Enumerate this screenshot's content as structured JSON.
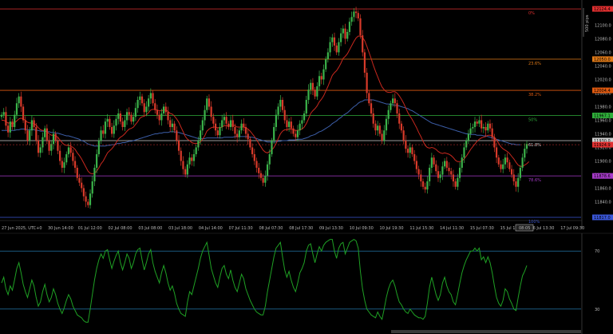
{
  "chart_data": [
    {
      "type": "candlestick",
      "title": "",
      "scale_label": "500 pips",
      "ylim": [
        11817,
        12130
      ],
      "price_ticks": [
        12100,
        12080,
        12060,
        12040,
        12020,
        12000,
        11980,
        11960,
        11940,
        11920,
        11900,
        11880,
        11860,
        11840
      ],
      "price_tick_labels": [
        "12100.0",
        "12080.0",
        "12060.0",
        "12040.0",
        "12020.0",
        "12000.0",
        "11980.0",
        "11960.0",
        "11940.0",
        "11920.0",
        "11900.0",
        "11880.0",
        "11860.0",
        "11840.0"
      ],
      "time_labels": [
        "27 Jun 2025, UTC+0",
        "30 Jun 14:00",
        "01 Jul 12:00",
        "02 Jul 08:00",
        "03 Jul 08:00",
        "03 Jul 18:00",
        "04 Jul 14:00",
        "07 Jul 11:30",
        "08 Jul 07:30",
        "08 Jul 17:30",
        "09 Jul 13:30",
        "10 Jul 09:30",
        "10 Jul 19:30",
        "11 Jul 15:30",
        "14 Jul 11:30",
        "15 Jul 07:30",
        "15 Jul 17:30",
        "16 Jul 13:30",
        "17 Jul 09:30"
      ],
      "cursor_time_label": "08:05",
      "fib_levels": [
        {
          "label": "0%",
          "price": 12124,
          "color": "#e03030",
          "tag": "12124.4"
        },
        {
          "label": "23.6%",
          "price": 12050,
          "color": "#e07a18",
          "tag": "12050.0"
        },
        {
          "label": "38.2%",
          "price": 12004,
          "color": "#e05a10",
          "tag": "12004.4"
        },
        {
          "label": "50%",
          "price": 11967,
          "color": "#2fae3a",
          "tag": "11967.1"
        },
        {
          "label": "61.8%",
          "price": 11930,
          "color": "#cfcfcf",
          "tag": "11930.0"
        },
        {
          "label": "78.6%",
          "price": 11878,
          "color": "#a63ac8",
          "tag": "11878.6"
        },
        {
          "label": "100%",
          "price": 11817,
          "color": "#3a56d6",
          "tag": "11817.0"
        }
      ],
      "current_price": {
        "price": 11924,
        "tag": "11924.9",
        "color": "#e03030"
      },
      "series_closes": [
        11968,
        11972,
        11952,
        11942,
        11958,
        11950,
        11968,
        11985,
        11995,
        11980,
        11960,
        11945,
        11930,
        11945,
        11960,
        11950,
        11930,
        11912,
        11920,
        11935,
        11948,
        11930,
        11915,
        11925,
        11940,
        11930,
        11915,
        11900,
        11890,
        11898,
        11910,
        11920,
        11912,
        11900,
        11890,
        11875,
        11868,
        11860,
        11848,
        11840,
        11835,
        11852,
        11870,
        11890,
        11910,
        11930,
        11945,
        11940,
        11958,
        11962,
        11950,
        11940,
        11952,
        11962,
        11970,
        11958,
        11950,
        11960,
        11972,
        11968,
        11958,
        11965,
        11978,
        11990,
        11995,
        11985,
        11972,
        11980,
        11992,
        12000,
        11985,
        11975,
        11968,
        11960,
        11970,
        11980,
        11972,
        11960,
        11950,
        11955,
        11945,
        11930,
        11915,
        11900,
        11888,
        11880,
        11895,
        11905,
        11900,
        11910,
        11920,
        11930,
        11945,
        11960,
        11975,
        11992,
        11980,
        11965,
        11955,
        11945,
        11938,
        11950,
        11960,
        11965,
        11955,
        11950,
        11960,
        11950,
        11940,
        11935,
        11945,
        11955,
        11950,
        11940,
        11932,
        11920,
        11910,
        11900,
        11890,
        11882,
        11875,
        11868,
        11878,
        11895,
        11910,
        11930,
        11950,
        11968,
        11980,
        11990,
        11975,
        11960,
        11950,
        11958,
        11948,
        11940,
        11935,
        11945,
        11955,
        11960,
        11970,
        11990,
        12005,
        12015,
        12005,
        11995,
        12010,
        12025,
        12020,
        12035,
        12050,
        12060,
        12075,
        12082,
        12070,
        12060,
        12075,
        12088,
        12095,
        12080,
        12090,
        12105,
        12112,
        12120,
        12118,
        12110,
        12085,
        12060,
        12030,
        12000,
        11985,
        11970,
        11955,
        11945,
        11952,
        11940,
        11930,
        11945,
        11962,
        11975,
        11985,
        11992,
        11985,
        11970,
        11955,
        11945,
        11930,
        11918,
        11912,
        11920,
        11910,
        11900,
        11888,
        11880,
        11870,
        11862,
        11858,
        11870,
        11890,
        11905,
        11895,
        11885,
        11875,
        11880,
        11892,
        11900,
        11890,
        11885,
        11880,
        11870,
        11862,
        11875,
        11890,
        11905,
        11920,
        11930,
        11940,
        11948,
        11950,
        11958,
        11955,
        11960,
        11948,
        11950,
        11945,
        11955,
        11948,
        11935,
        11920,
        11905,
        11895,
        11888,
        11895,
        11905,
        11898,
        11888,
        11880,
        11870,
        11862,
        11875,
        11890,
        11905,
        11918,
        11925
      ],
      "ema_fast": [
        11960,
        11960,
        11958,
        11956,
        11956,
        11955,
        11956,
        11959,
        11962,
        11963,
        11962,
        11960,
        11957,
        11956,
        11956,
        11955,
        11953,
        11949,
        11946,
        11945,
        11945,
        11943,
        11940,
        11938,
        11938,
        11937,
        11935,
        11931,
        11927,
        11924,
        11923,
        11923,
        11922,
        11920,
        11917,
        11912,
        11908,
        11903,
        11897,
        11891,
        11885,
        11882,
        11881,
        11882,
        11885,
        11890,
        11896,
        11900,
        11906,
        11912,
        11915,
        11918,
        11922,
        11927,
        11932,
        11935,
        11937,
        11940,
        11944,
        11947,
        11948,
        11950,
        11954,
        11958,
        11963,
        11965,
        11966,
        11968,
        11971,
        11975,
        11976,
        11976,
        11975,
        11974,
        11974,
        11975,
        11975,
        11973,
        11970,
        11969,
        11966,
        11962,
        11957,
        11950,
        11943,
        11936,
        11932,
        11930,
        11927,
        11926,
        11926,
        11926,
        11928,
        11932,
        11937,
        11944,
        11947,
        11949,
        11950,
        11950,
        11949,
        11949,
        11950,
        11952,
        11952,
        11952,
        11953,
        11953,
        11952,
        11950,
        11950,
        11950,
        11950,
        11949,
        11947,
        11944,
        11940,
        11936,
        11931,
        11926,
        11921,
        11916,
        11913,
        11912,
        11914,
        11916,
        11920,
        11926,
        11933,
        11940,
        11944,
        11946,
        11946,
        11947,
        11947,
        11946,
        11945,
        11945,
        11946,
        11947,
        11950,
        11955,
        11962,
        11970,
        11974,
        11977,
        11981,
        11987,
        11991,
        11996,
        12003,
        12010,
        12018,
        12026,
        12030,
        12033,
        12038,
        12044,
        12051,
        12054,
        12058,
        12064,
        12070,
        12076,
        12081,
        12084,
        12084,
        12082,
        12077,
        12069,
        12060,
        12051,
        12041,
        12032,
        12024,
        12016,
        12009,
        12005,
        12002,
        12001,
        12001,
        12002,
        12002,
        12000,
        11996,
        11991,
        11985,
        11978,
        11971,
        11966,
        11961,
        11955,
        11949,
        11942,
        11936,
        11929,
        11923,
        11920,
        11919,
        11920,
        11919,
        11917,
        11914,
        11912,
        11911,
        11912,
        11911,
        11910,
        11908,
        11905,
        11901,
        11899,
        11899,
        11900,
        11903,
        11907,
        11912,
        11917,
        11921,
        11925,
        11929,
        11932,
        11934,
        11935,
        11936,
        11938,
        11938,
        11937,
        11935,
        11931,
        11926,
        11921,
        11918,
        11916,
        11914,
        11911,
        11907,
        11903,
        11898,
        11894,
        11892,
        11892,
        11894,
        11896,
        11899
      ],
      "ema_slow": [
        11945,
        11945,
        11945,
        11945,
        11945,
        11945,
        11945,
        11946,
        11946,
        11947,
        11947,
        11947,
        11946,
        11946,
        11946,
        11946,
        11945,
        11945,
        11944,
        11944,
        11944,
        11943,
        11943,
        11942,
        11942,
        11941,
        11941,
        11940,
        11939,
        11938,
        11937,
        11937,
        11936,
        11935,
        11934,
        11933,
        11932,
        11930,
        11929,
        11927,
        11925,
        11924,
        11923,
        11922,
        11922,
        11922,
        11922,
        11922,
        11922,
        11923,
        11923,
        11924,
        11924,
        11925,
        11926,
        11926,
        11927,
        11927,
        11928,
        11929,
        11929,
        11930,
        11931,
        11932,
        11933,
        11934,
        11935,
        11936,
        11937,
        11938,
        11939,
        11940,
        11940,
        11941,
        11941,
        11942,
        11942,
        11942,
        11943,
        11943,
        11943,
        11942,
        11942,
        11941,
        11940,
        11939,
        11938,
        11937,
        11936,
        11935,
        11934,
        11933,
        11933,
        11933,
        11933,
        11934,
        11934,
        11934,
        11934,
        11934,
        11934,
        11934,
        11934,
        11935,
        11935,
        11935,
        11935,
        11935,
        11936,
        11936,
        11936,
        11936,
        11936,
        11936,
        11936,
        11935,
        11935,
        11934,
        11933,
        11932,
        11931,
        11930,
        11929,
        11928,
        11928,
        11928,
        11928,
        11928,
        11929,
        11929,
        11930,
        11930,
        11930,
        11931,
        11931,
        11931,
        11931,
        11932,
        11932,
        11932,
        11933,
        11934,
        11935,
        11937,
        11938,
        11939,
        11941,
        11943,
        11944,
        11946,
        11948,
        11950,
        11952,
        11955,
        11957,
        11959,
        11962,
        11964,
        11967,
        11969,
        11971,
        11974,
        11977,
        11980,
        11982,
        11985,
        11987,
        11988,
        11990,
        11990,
        11990,
        11990,
        11990,
        11989,
        11988,
        11987,
        11986,
        11985,
        11984,
        11984,
        11983,
        11983,
        11982,
        11982,
        11981,
        11980,
        11979,
        11978,
        11977,
        11975,
        11974,
        11972,
        11970,
        11968,
        11966,
        11964,
        11962,
        11960,
        11958,
        11956,
        11955,
        11954,
        11953,
        11952,
        11951,
        11950,
        11949,
        11948,
        11947,
        11946,
        11945,
        11944,
        11943,
        11942,
        11941,
        11940,
        11940,
        11939,
        11939,
        11939,
        11938,
        11938,
        11938,
        11937,
        11937,
        11936,
        11935,
        11934,
        11933,
        11932,
        11931,
        11930,
        11929,
        11928,
        11927,
        11926,
        11925,
        11925,
        11924,
        11924,
        11924
      ],
      "colors": {
        "up": "#3bb34a",
        "down": "#d83a2a",
        "ema_fast": "#c8281e",
        "ema_slow": "#3c5ea8"
      }
    },
    {
      "type": "line",
      "title": "",
      "ylim": [
        20,
        80
      ],
      "levels": [
        70,
        30
      ],
      "level_labels": [
        "70",
        "30"
      ],
      "values": [
        48,
        52,
        44,
        40,
        46,
        43,
        50,
        58,
        62,
        55,
        47,
        42,
        38,
        44,
        50,
        46,
        38,
        32,
        35,
        42,
        47,
        40,
        35,
        38,
        44,
        40,
        34,
        30,
        27,
        31,
        36,
        40,
        37,
        32,
        29,
        26,
        25,
        24,
        22,
        21,
        21,
        30,
        40,
        50,
        58,
        64,
        68,
        65,
        70,
        71,
        64,
        58,
        63,
        67,
        70,
        62,
        57,
        62,
        68,
        65,
        58,
        62,
        68,
        71,
        72,
        64,
        57,
        62,
        68,
        71,
        62,
        56,
        52,
        48,
        55,
        60,
        55,
        48,
        43,
        46,
        41,
        34,
        30,
        27,
        26,
        25,
        35,
        42,
        40,
        46,
        52,
        58,
        65,
        70,
        73,
        76,
        67,
        58,
        53,
        48,
        45,
        52,
        58,
        60,
        54,
        51,
        57,
        50,
        45,
        42,
        48,
        54,
        51,
        44,
        40,
        36,
        33,
        30,
        28,
        27,
        26,
        26,
        32,
        42,
        50,
        58,
        66,
        72,
        74,
        76,
        66,
        57,
        52,
        56,
        50,
        45,
        42,
        48,
        55,
        58,
        62,
        70,
        74,
        75,
        68,
        62,
        68,
        73,
        70,
        74,
        76,
        77,
        78,
        78,
        70,
        65,
        72,
        75,
        76,
        68,
        72,
        76,
        77,
        78,
        77,
        72,
        56,
        44,
        36,
        30,
        28,
        26,
        25,
        24,
        28,
        25,
        23,
        30,
        38,
        44,
        48,
        50,
        46,
        40,
        35,
        33,
        30,
        28,
        27,
        30,
        28,
        26,
        25,
        24,
        24,
        23,
        25,
        34,
        45,
        52,
        46,
        40,
        36,
        40,
        48,
        52,
        46,
        42,
        40,
        35,
        33,
        40,
        48,
        55,
        60,
        64,
        67,
        70,
        70,
        72,
        70,
        72,
        64,
        66,
        62,
        66,
        62,
        55,
        46,
        38,
        34,
        32,
        36,
        44,
        42,
        37,
        34,
        30,
        29,
        38,
        46,
        53,
        56,
        60
      ]
    }
  ]
}
